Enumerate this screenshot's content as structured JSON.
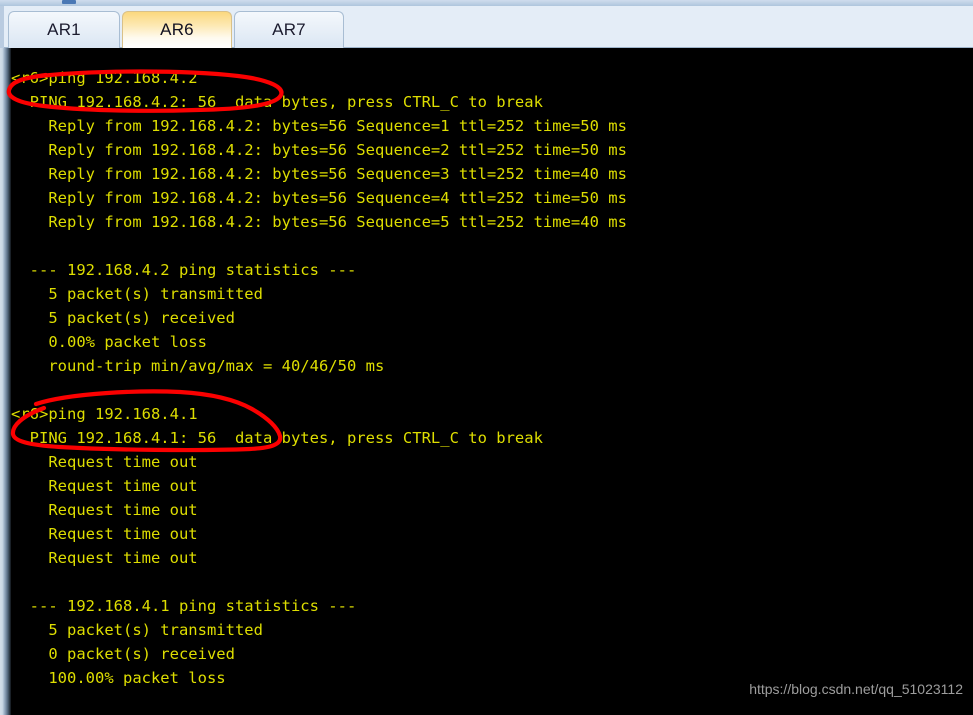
{
  "window": {
    "chrome_color": "#bdd0e4",
    "tabbar_bg": "#e4edf7"
  },
  "tabs": {
    "items": [
      {
        "label": "AR1",
        "active": false
      },
      {
        "label": "AR6",
        "active": true
      },
      {
        "label": "AR7",
        "active": false
      }
    ],
    "active_index": 1,
    "active_color": "#fbd87e"
  },
  "terminal": {
    "background": "#000000",
    "foreground": "#dede00",
    "prompt": "<r6>",
    "lines": [
      "<r6>ping 192.168.4.2",
      "  PING 192.168.4.2: 56  data bytes, press CTRL_C to break",
      "    Reply from 192.168.4.2: bytes=56 Sequence=1 ttl=252 time=50 ms",
      "    Reply from 192.168.4.2: bytes=56 Sequence=2 ttl=252 time=50 ms",
      "    Reply from 192.168.4.2: bytes=56 Sequence=3 ttl=252 time=40 ms",
      "    Reply from 192.168.4.2: bytes=56 Sequence=4 ttl=252 time=50 ms",
      "    Reply from 192.168.4.2: bytes=56 Sequence=5 ttl=252 time=40 ms",
      "",
      "  --- 192.168.4.2 ping statistics ---",
      "    5 packet(s) transmitted",
      "    5 packet(s) received",
      "    0.00% packet loss",
      "    round-trip min/avg/max = 40/46/50 ms",
      "",
      "<r6>ping 192.168.4.1",
      "  PING 192.168.4.1: 56  data bytes, press CTRL_C to break",
      "    Request time out",
      "    Request time out",
      "    Request time out",
      "    Request time out",
      "    Request time out",
      "",
      "  --- 192.168.4.1 ping statistics ---",
      "    5 packet(s) transmitted",
      "    0 packet(s) received",
      "    100.00% packet loss"
    ]
  },
  "annotations": {
    "color": "#ff0000",
    "marks": [
      {
        "name": "circle-ping-192-168-4-2",
        "target": "<r6>ping 192.168.4.2"
      },
      {
        "name": "circle-ping-192-168-4-1",
        "target": "<r6>ping 192.168.4.1"
      }
    ]
  },
  "watermark": {
    "text": "https://blog.csdn.net/qq_51023112"
  }
}
